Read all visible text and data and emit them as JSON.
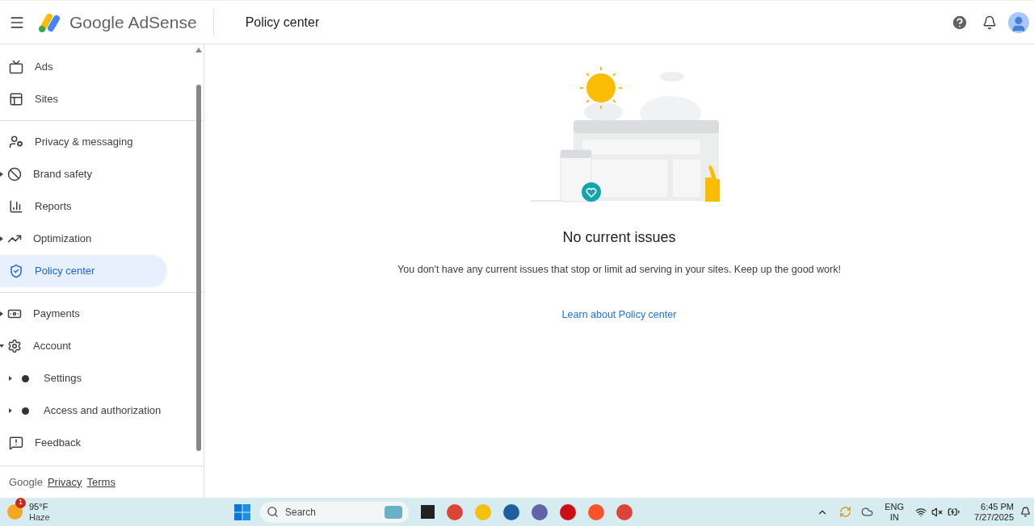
{
  "header": {
    "product": "Google AdSense",
    "page_title": "Policy center"
  },
  "sidebar": {
    "groups": [
      [
        {
          "label": "Ads",
          "expandable": false,
          "selected": false
        },
        {
          "label": "Sites",
          "expandable": false,
          "selected": false
        }
      ],
      [
        {
          "label": "Privacy & messaging",
          "expandable": false,
          "selected": false
        },
        {
          "label": "Brand safety",
          "expandable": true,
          "expanded": false,
          "selected": false
        },
        {
          "label": "Reports",
          "expandable": false,
          "selected": false
        },
        {
          "label": "Optimization",
          "expandable": true,
          "expanded": false,
          "selected": false
        },
        {
          "label": "Policy center",
          "expandable": false,
          "selected": true
        }
      ],
      [
        {
          "label": "Payments",
          "expandable": true,
          "expanded": false,
          "selected": false
        },
        {
          "label": "Account",
          "expandable": true,
          "expanded": true,
          "selected": false,
          "children": [
            {
              "label": "Settings",
              "expandable": true,
              "expanded": false,
              "selected": false
            },
            {
              "label": "Access and authorization",
              "expandable": true,
              "expanded": false,
              "selected": false
            }
          ]
        },
        {
          "label": "Feedback",
          "expandable": false,
          "selected": false
        }
      ]
    ],
    "footer": {
      "brand": "Google",
      "links": [
        "Privacy",
        "Terms"
      ]
    }
  },
  "main": {
    "title": "No current issues",
    "message": "You don't have any current issues that stop or limit ad serving in your sites. Keep up the good work!",
    "link": "Learn about Policy center"
  },
  "taskbar": {
    "weather": {
      "badge": "1",
      "temperature": "95°F",
      "condition": "Haze"
    },
    "search": "Search",
    "tray": {
      "language": "ENG",
      "region": "IN",
      "time": "6:45 PM",
      "date": "7/27/2025"
    }
  }
}
